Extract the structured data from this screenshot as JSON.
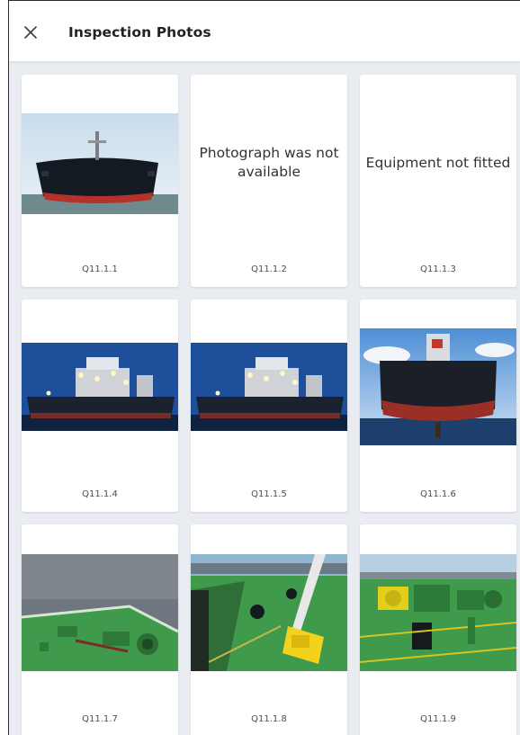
{
  "header": {
    "title": "Inspection Photos",
    "close_icon": "close-icon"
  },
  "photos": [
    {
      "code": "Q11.1.1",
      "kind": "image",
      "subject": "ship bow"
    },
    {
      "code": "Q11.1.2",
      "kind": "message",
      "message": "Photograph was not available"
    },
    {
      "code": "Q11.1.3",
      "kind": "message",
      "message": "Equipment not fitted"
    },
    {
      "code": "Q11.1.4",
      "kind": "image",
      "subject": "ship at night"
    },
    {
      "code": "Q11.1.5",
      "kind": "image",
      "subject": "ship at night"
    },
    {
      "code": "Q11.1.6",
      "kind": "image",
      "subject": "ship stern"
    },
    {
      "code": "Q11.1.7",
      "kind": "image",
      "subject": "bow deck"
    },
    {
      "code": "Q11.1.8",
      "kind": "image",
      "subject": "deck crane"
    },
    {
      "code": "Q11.1.9",
      "kind": "image",
      "subject": "mooring winches"
    }
  ],
  "colors": {
    "background": "#e9edf1",
    "card": "#ffffff",
    "deck_green": "#3f9a4c",
    "hull": "#1d2430",
    "hull_red": "#b5322a"
  }
}
